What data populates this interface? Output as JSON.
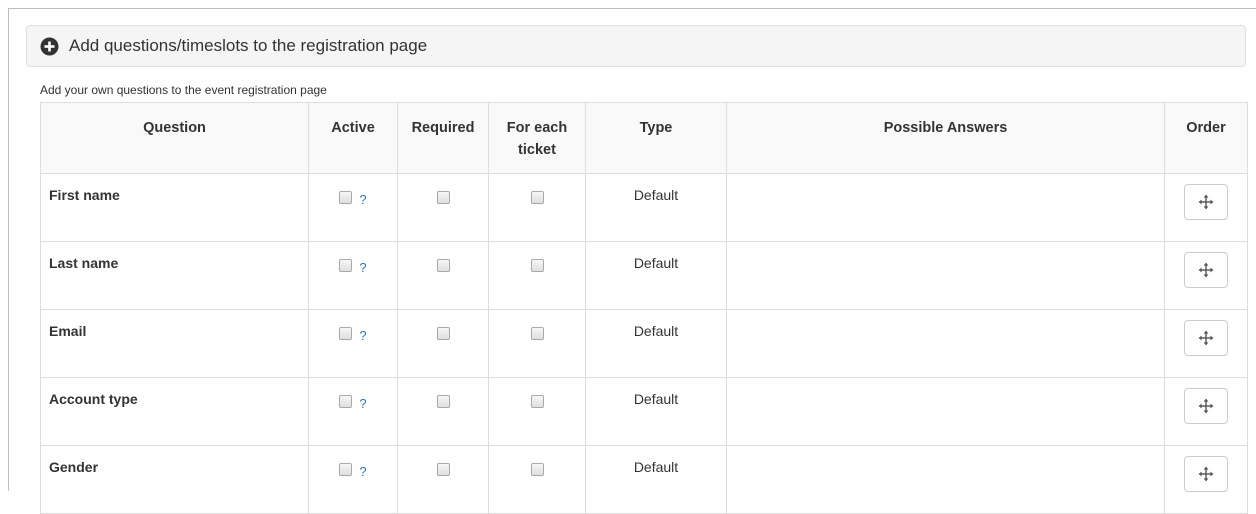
{
  "panel": {
    "title": "Add questions/timeslots to the registration page",
    "icon": "plus-circle-icon"
  },
  "helper_text": "Add your own questions to the event registration page",
  "table": {
    "headers": {
      "question": "Question",
      "active": "Active",
      "required": "Required",
      "for_each_ticket_line1": "For each",
      "for_each_ticket_line2": "ticket",
      "type": "Type",
      "possible_answers": "Possible Answers",
      "order": "Order"
    },
    "help_label": "?",
    "rows": [
      {
        "question": "First name",
        "type": "Default",
        "possible_answers": ""
      },
      {
        "question": "Last name",
        "type": "Default",
        "possible_answers": ""
      },
      {
        "question": "Email",
        "type": "Default",
        "possible_answers": ""
      },
      {
        "question": "Account type",
        "type": "Default",
        "possible_answers": ""
      },
      {
        "question": "Gender",
        "type": "Default",
        "possible_answers": ""
      }
    ]
  },
  "colors": {
    "link": "#3277b5",
    "header_bg": "#f9f9f9",
    "panel_bg": "#f5f5f5",
    "border": "#dddddd"
  }
}
